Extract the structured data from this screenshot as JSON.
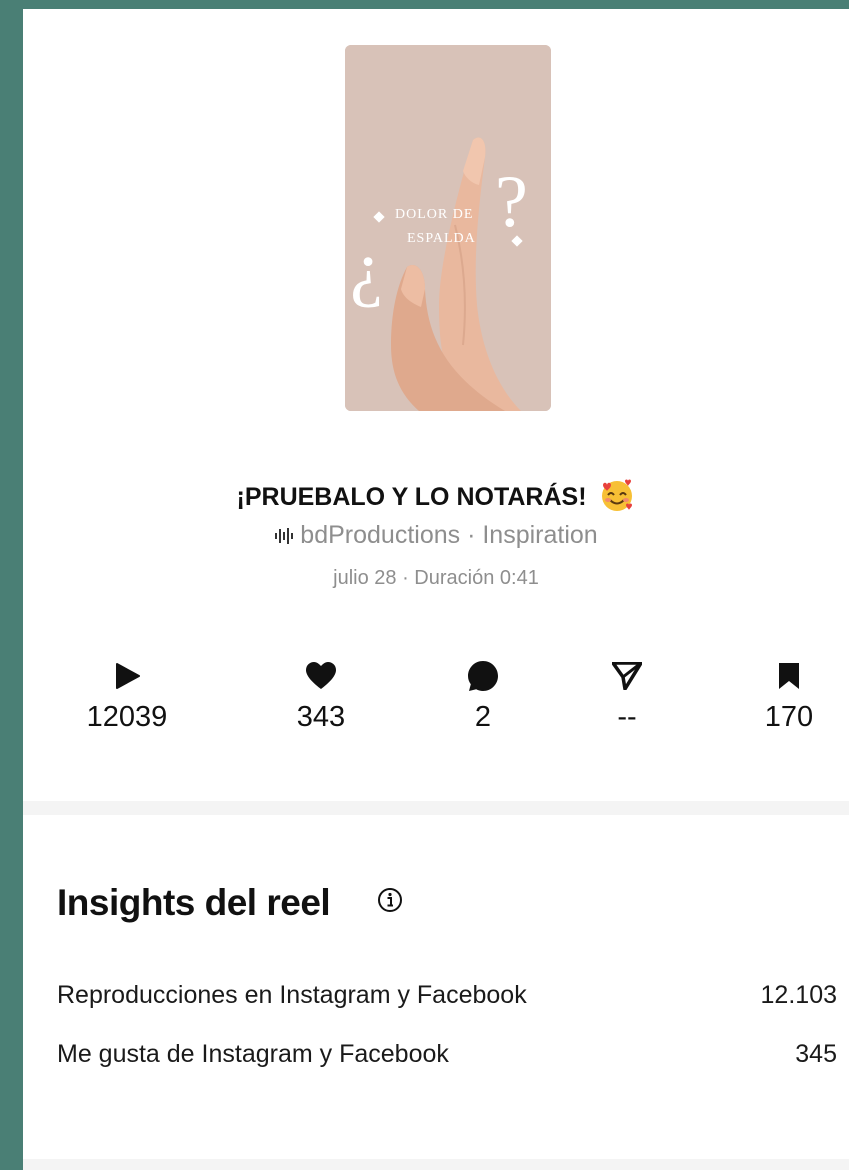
{
  "reel": {
    "thumbnail": {
      "line1": "DOLOR DE",
      "line2": "ESPALDA",
      "open_q": "¿",
      "close_q": "?"
    },
    "caption": "¡PRUEBALO Y LO NOTARÁS!",
    "caption_emoji": "smiling-face-with-hearts",
    "audio": "bdProductions · Inspiration",
    "meta": "julio 28 · Duración 0:41"
  },
  "stats": [
    {
      "icon": "play-icon",
      "value": "12039"
    },
    {
      "icon": "heart-icon",
      "value": "343"
    },
    {
      "icon": "comment-icon",
      "value": "2"
    },
    {
      "icon": "share-icon",
      "value": "--"
    },
    {
      "icon": "bookmark-icon",
      "value": "170"
    }
  ],
  "insights": {
    "title": "Insights del reel",
    "rows": [
      {
        "label": "Reproducciones en Instagram y Facebook",
        "value": "12.103"
      },
      {
        "label": "Me gusta de Instagram y Facebook",
        "value": "345"
      }
    ]
  },
  "colors": {
    "frame": "#4a7f75",
    "thumb_bg": "#d8c2b8",
    "muted_text": "#8e8e8e"
  }
}
